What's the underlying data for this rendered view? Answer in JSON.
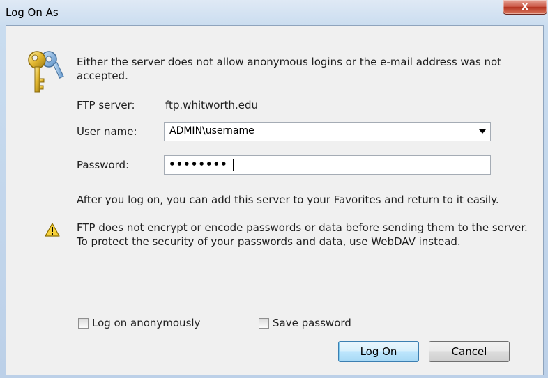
{
  "window": {
    "title": "Log On As",
    "close_label": "X"
  },
  "message": "Either the server does not allow anonymous logins or the e-mail address was not accepted.",
  "ftp_server": {
    "label": "FTP server:",
    "value": "ftp.whitworth.edu"
  },
  "user_name": {
    "label": "User name:",
    "value": "ADMIN\\username"
  },
  "password": {
    "label": "Password:",
    "masked_value": "••••••••"
  },
  "info_note": "After you log on, you can add this server to your Favorites and return to it easily.",
  "warning": "FTP does not encrypt or encode passwords or data before sending them to the server.  To protect the security of your passwords and data, use WebDAV instead.",
  "options": {
    "anonymous_label": "Log on anonymously",
    "anonymous_checked": false,
    "save_password_label": "Save password",
    "save_password_checked": false
  },
  "buttons": {
    "logon": "Log On",
    "cancel": "Cancel"
  },
  "icons": {
    "key": "key-icon",
    "warning": "warning-icon",
    "dropdown": "chevron-down-icon"
  }
}
